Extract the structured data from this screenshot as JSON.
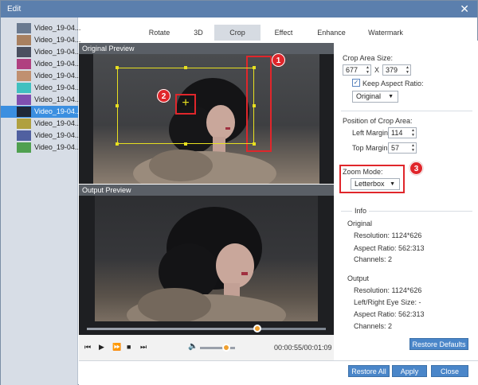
{
  "window": {
    "title": "Edit",
    "close_icon": "close-icon"
  },
  "videos": [
    {
      "label": "Video_19-04...",
      "thumb_color": "#6a7a90"
    },
    {
      "label": "Video_19-04...",
      "thumb_color": "#a88060"
    },
    {
      "label": "Video_19-04...",
      "thumb_color": "#4a5060"
    },
    {
      "label": "Video_19-04...",
      "thumb_color": "#b04080"
    },
    {
      "label": "Video_19-04...",
      "thumb_color": "#c09070"
    },
    {
      "label": "Video_19-04...",
      "thumb_color": "#40c0c0"
    },
    {
      "label": "Video_19-04...",
      "thumb_color": "#8050b0"
    },
    {
      "label": "Video_19-04...",
      "thumb_color": "#202838"
    },
    {
      "label": "Video_19-04...",
      "thumb_color": "#b0a040"
    },
    {
      "label": "Video_19-04...",
      "thumb_color": "#5060a0"
    },
    {
      "label": "Video_19-04...",
      "thumb_color": "#50a050"
    }
  ],
  "selected_video_index": 7,
  "tabs": [
    "Rotate",
    "3D",
    "Crop",
    "Effect",
    "Enhance",
    "Watermark"
  ],
  "active_tab": "Crop",
  "original_preview": {
    "title": "Original Preview"
  },
  "output_preview": {
    "title": "Output Preview"
  },
  "player": {
    "time": "00:00:55/00:01:09",
    "progress": 0.72,
    "volume": 0.4
  },
  "crop": {
    "area_size_label": "Crop Area Size:",
    "width": "677",
    "x_sep": "X",
    "height": "379",
    "keep_aspect_label": "Keep Aspect Ratio:",
    "keep_aspect_checked": true,
    "aspect_value": "Original",
    "position_label": "Position of Crop Area:",
    "left_margin_label": "Left Margin:",
    "left_margin": "114",
    "top_margin_label": "Top Margin:",
    "top_margin": "57",
    "zoom_mode_label": "Zoom Mode:",
    "zoom_mode": "Letterbox"
  },
  "info": {
    "title": "Info",
    "original_heading": "Original",
    "original_resolution": "Resolution: 1124*626",
    "original_aspect": "Aspect Ratio: 562:313",
    "original_channels": "Channels: 2",
    "output_heading": "Output",
    "output_resolution": "Resolution: 1124*626",
    "output_eye_size": "Left/Right Eye Size: -",
    "output_aspect": "Aspect Ratio: 562:313",
    "output_channels": "Channels: 2"
  },
  "buttons": {
    "restore_defaults": "Restore Defaults",
    "restore_all": "Restore All",
    "apply": "Apply",
    "close": "Close"
  },
  "badges": [
    "1",
    "2",
    "3"
  ],
  "colors": {
    "accent": "#4a86c9",
    "annotation": "#e0262b",
    "crop_frame": "#e8e020",
    "selection": "#3b8fe0"
  }
}
